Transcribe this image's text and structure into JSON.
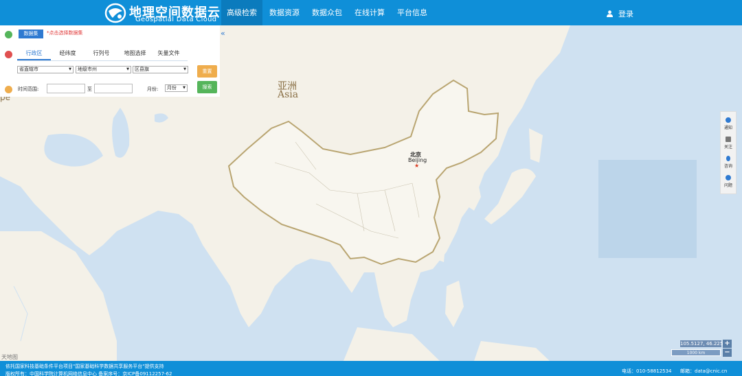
{
  "header": {
    "logo_cn": "地理空间数据云",
    "logo_en": "Geospatial Data Cloud",
    "nav": [
      "高级检索",
      "数据资源",
      "数据众包",
      "在线计算",
      "平台信息"
    ],
    "login": "登录"
  },
  "panel": {
    "dataset_button": "数据集",
    "dataset_hint": "*点击选择数据集",
    "tabs": [
      "行政区",
      "经纬度",
      "行列号",
      "地图选择",
      "矢量文件"
    ],
    "selects": [
      "省直辖市",
      "地级市州",
      "区县旗"
    ],
    "reset_button": "重置",
    "search_button": "搜索",
    "time_label": "时间范围:",
    "to_label": "至",
    "month_label": "月份:",
    "month_select": "月份"
  },
  "map": {
    "continent_cn": "亚洲",
    "continent_en": "Asia",
    "capital_cn": "北京",
    "capital_en": "Beijing",
    "watermark": "天地图",
    "partial_left": "pe",
    "collapse_glyph": "«",
    "coords": "105.5127, 46.2255",
    "scale": "1000 km",
    "zoom_in": "+",
    "zoom_out": "−"
  },
  "float_bar": [
    "通知",
    "关注",
    "咨询",
    "问题"
  ],
  "footer": {
    "line1": "依托国家科技基础条件平台项目\"国家基础科学数据共享服务平台\"提供支持",
    "line2": "版权所有：中国科学院计算机网络信息中心 备案序号：京ICP备09112257-62",
    "phone": "电话：010-58812534",
    "email": "邮箱：data@cnic.cn"
  },
  "colors": {
    "header": "#0f8fd8",
    "active_nav": "#0b7bbd",
    "water": "#cfe1f1",
    "land": "#f4f1e8",
    "china": "#f8f6ef",
    "border": "#b9a571",
    "reset": "#efad4d",
    "search": "#55b55b",
    "accent": "#2f7ad1"
  }
}
